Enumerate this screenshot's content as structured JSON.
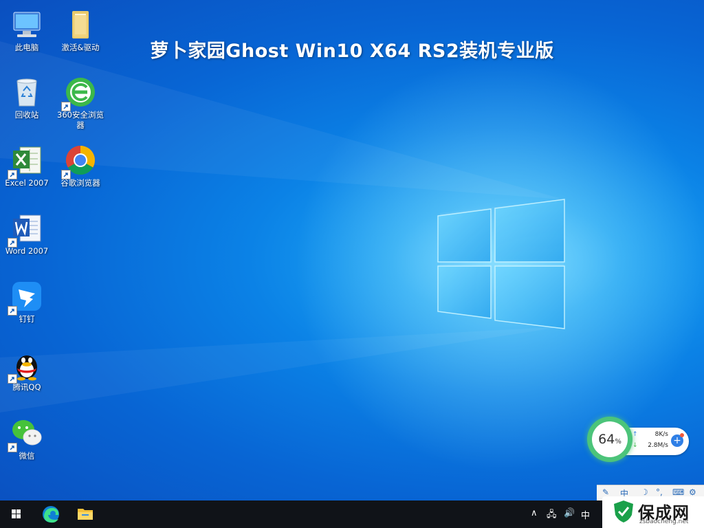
{
  "desktop": {
    "title": "萝卜家园Ghost Win10 X64 RS2装机专业版",
    "icons": [
      {
        "label": "此电脑",
        "icon": "computer-icon"
      },
      {
        "label": "激活&驱动",
        "icon": "folder-icon"
      },
      {
        "label": "回收站",
        "icon": "recycle-bin-icon"
      },
      {
        "label": "360安全浏览器",
        "icon": "360-browser-icon"
      },
      {
        "label": "Excel 2007",
        "icon": "excel-icon"
      },
      {
        "label": "谷歌浏览器",
        "icon": "chrome-icon"
      },
      {
        "label": "Word 2007",
        "icon": "word-icon"
      },
      {
        "label": "钉钉",
        "icon": "dingtalk-icon"
      },
      {
        "label": "腾讯QQ",
        "icon": "qq-icon"
      },
      {
        "label": "微信",
        "icon": "wechat-icon"
      }
    ]
  },
  "net_widget": {
    "usage_value": "64",
    "usage_unit": "%",
    "upload": "8K/s",
    "download": "2.8M/s"
  },
  "taskbar": {
    "ime": "中",
    "tray_icons": [
      "chevron-up-icon",
      "network-icon",
      "volume-icon"
    ]
  },
  "watermark": {
    "name": "保成网",
    "url": "zsbaocheng.net"
  },
  "colors": {
    "desktop_blue": "#0b82e6",
    "taskbar": "#101318",
    "ring_green": "#4cc47a"
  }
}
